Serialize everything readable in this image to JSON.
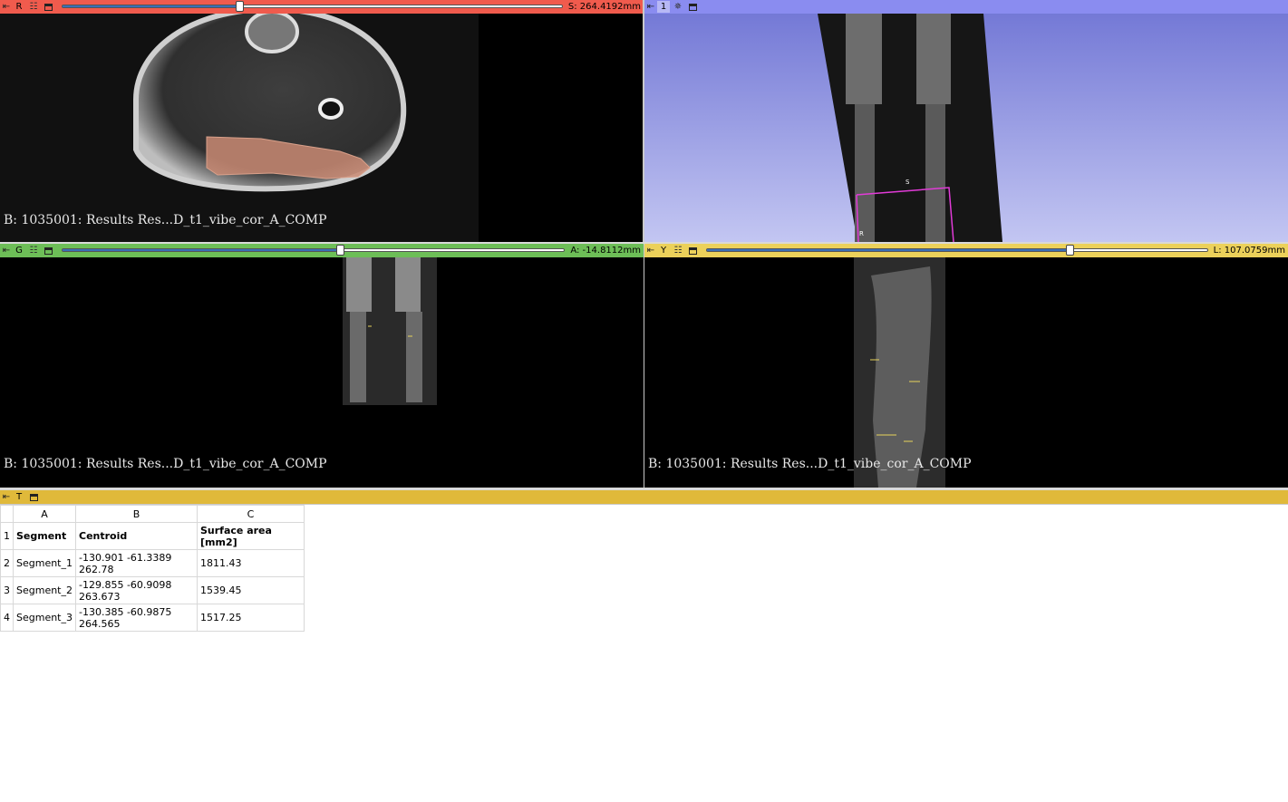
{
  "views": {
    "red": {
      "letter": "R",
      "offset": "S: 264.4192mm",
      "slider_fraction": 0.35,
      "label": "B: 1035001: Results Res...D_t1_vibe_cor_A_COMP"
    },
    "threed": {
      "letter": "1",
      "box_labels": {
        "s": "S",
        "r": "R"
      }
    },
    "green": {
      "letter": "G",
      "offset": "A: -14.8112mm",
      "slider_fraction": 0.56,
      "label": "B: 1035001: Results Res...D_t1_vibe_cor_A_COMP"
    },
    "yellow": {
      "letter": "Y",
      "offset": "L: 107.0759mm",
      "slider_fraction": 0.72,
      "label": "B: 1035001: Results Res...D_t1_vibe_cor_A_COMP"
    }
  },
  "table_view": {
    "letter": "T",
    "columns": [
      "A",
      "B",
      "C"
    ],
    "rows": [
      {
        "num": "1",
        "cells": [
          "Segment",
          "Centroid",
          "Surface area [mm2]"
        ]
      },
      {
        "num": "2",
        "cells": [
          "Segment_1",
          "-130.901 -61.3389 262.78",
          "1811.43"
        ]
      },
      {
        "num": "3",
        "cells": [
          "Segment_2",
          "-129.855 -60.9098 263.673",
          "1539.45"
        ]
      },
      {
        "num": "4",
        "cells": [
          "Segment_3",
          "-130.385 -60.9875 264.565",
          "1517.25"
        ]
      }
    ]
  },
  "colors": {
    "red_view": "#f05b4d",
    "blue_view": "#8a8cf0",
    "green_view": "#6dbe57",
    "yellow_view": "#ecd15a",
    "segment_fill": "#c98a73",
    "roi_box": "#e23bd8"
  },
  "icons": {
    "pin": "pin-icon",
    "link": "link-icon",
    "maximize": "maximize-view-icon",
    "center": "center-3d-icon"
  }
}
